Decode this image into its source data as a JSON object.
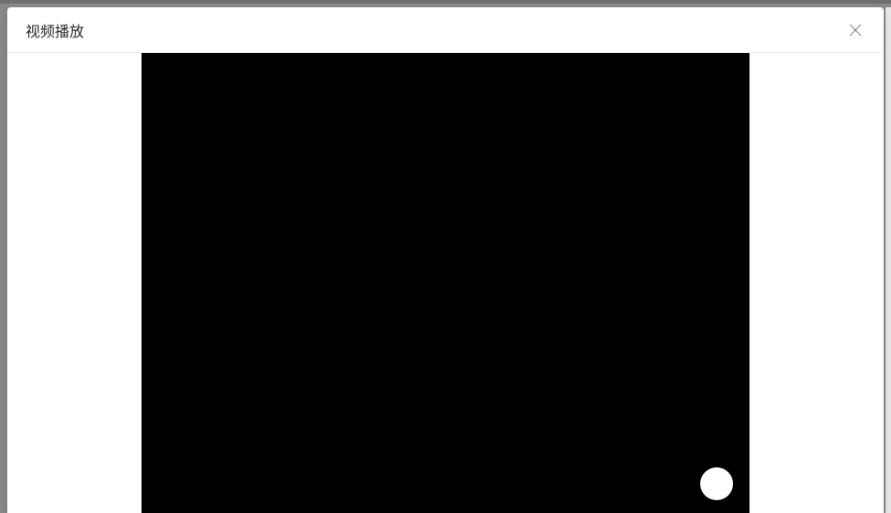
{
  "modal": {
    "title": "视频播放"
  },
  "icons": {
    "close": "close-icon"
  }
}
